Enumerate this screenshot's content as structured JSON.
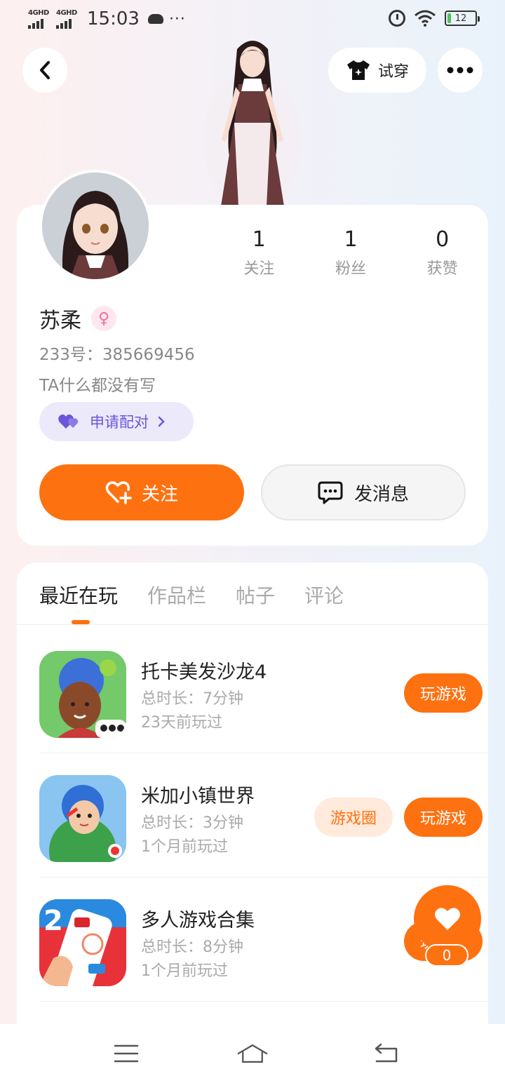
{
  "status_bar": {
    "network_1": "4GHD",
    "network_2": "4GHD",
    "time": "15:03",
    "dots": "···",
    "battery": "12",
    "battery_level": 0.12
  },
  "header": {
    "back_icon": "chevron-left-icon",
    "tryon_label": "试穿",
    "tryon_icon": "tshirt-icon",
    "more_icon": "more-horizontal-icon"
  },
  "profile": {
    "stats": [
      {
        "value": "1",
        "label": "关注"
      },
      {
        "value": "1",
        "label": "粉丝"
      },
      {
        "value": "0",
        "label": "获赞"
      }
    ],
    "name": "苏柔",
    "gender_icon": "female-icon",
    "uid": "233号：385669456",
    "bio": "TA什么都没有写",
    "pair_label": "申请配对",
    "follow_label": "关注",
    "message_label": "发消息"
  },
  "tabs": [
    {
      "label": "最近在玩",
      "active": true
    },
    {
      "label": "作品栏",
      "active": false
    },
    {
      "label": "帖子",
      "active": false
    },
    {
      "label": "评论",
      "active": false
    }
  ],
  "games": [
    {
      "title": "托卡美发沙龙4",
      "time": "总时长：7分钟",
      "last": "23天前玩过",
      "play": "玩游戏",
      "circle": ""
    },
    {
      "title": "米加小镇世界",
      "time": "总时长：3分钟",
      "last": "1个月前玩过",
      "play": "玩游戏",
      "circle": "游戏圈"
    },
    {
      "title": "多人游戏合集",
      "time": "总时长：8分钟",
      "last": "1个月前玩过",
      "play": "玩游戏",
      "circle": ""
    }
  ],
  "fab": {
    "icon": "heart-icon",
    "count": "0"
  },
  "colors": {
    "accent": "#fe7110",
    "pair": "#6b56d8"
  }
}
